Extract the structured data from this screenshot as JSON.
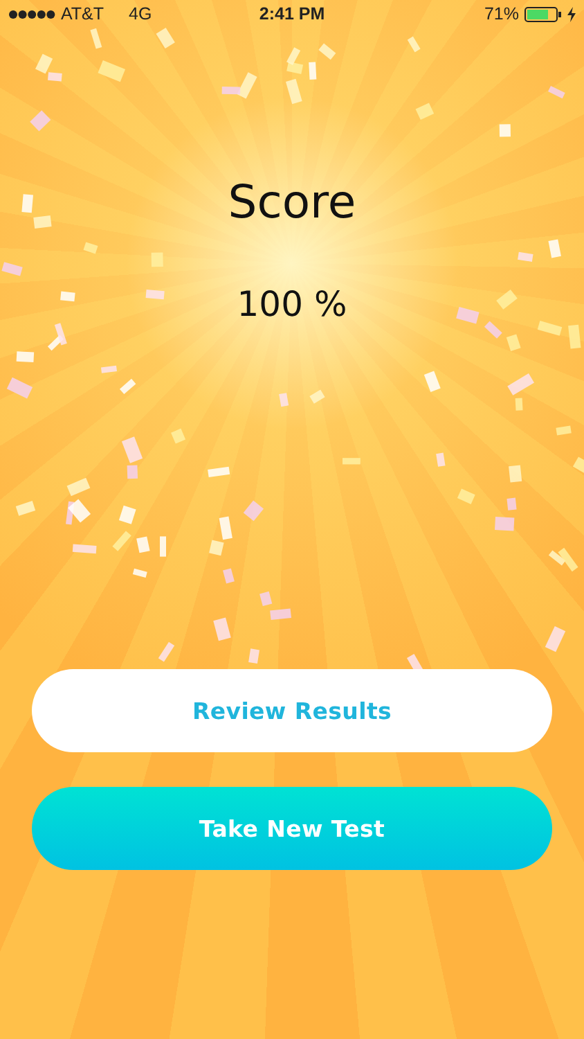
{
  "status_bar": {
    "carrier": "AT&T",
    "network": "4G",
    "time": "2:41 PM",
    "battery": "71%"
  },
  "score": {
    "title": "Score",
    "value": "100 %"
  },
  "buttons": [
    {
      "label": "Review Results",
      "kind": "secondary"
    },
    {
      "label": "Take New Test",
      "kind": "primary"
    }
  ]
}
